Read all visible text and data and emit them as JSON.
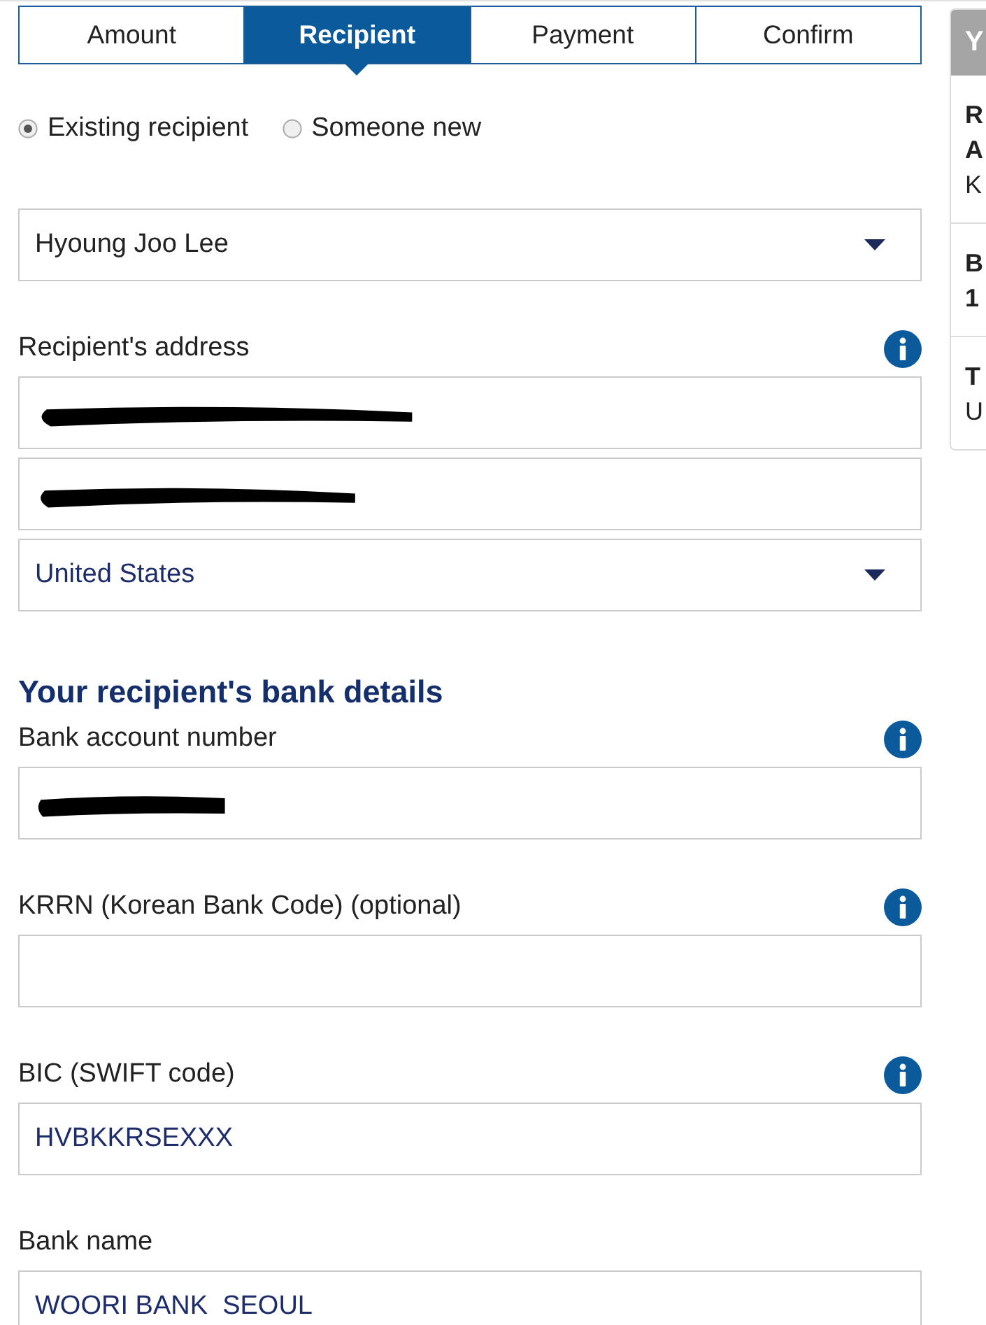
{
  "tabs": [
    {
      "label": "Amount",
      "selected": false
    },
    {
      "label": "Recipient",
      "selected": true
    },
    {
      "label": "Payment",
      "selected": false
    },
    {
      "label": "Confirm",
      "selected": false
    }
  ],
  "recipient_type": [
    {
      "label": "Existing recipient",
      "selected": true
    },
    {
      "label": "Someone new",
      "selected": false
    }
  ],
  "recipient_select": {
    "value": "Hyoung Joo Lee"
  },
  "address": {
    "label": "Recipient's address",
    "info": true,
    "lines": [
      {
        "kind": "text",
        "redacted": true
      },
      {
        "kind": "text",
        "redacted": true
      },
      {
        "kind": "select",
        "value": "United States",
        "redacted": false
      }
    ]
  },
  "bank_details": {
    "heading": "Your recipient's bank details",
    "fields": [
      {
        "label": "Bank account number",
        "info": true,
        "redacted": true
      },
      {
        "label": "KRRN (Korean Bank Code) (optional)",
        "info": true,
        "redacted": false
      },
      {
        "label": "BIC (SWIFT code)",
        "info": true,
        "redacted": false,
        "value": "HVBKKRSEXXX"
      },
      {
        "label": "Bank name",
        "info": false,
        "redacted": false,
        "value": "WOORI BANK  SEOUL"
      }
    ]
  },
  "summary_panel": {
    "title": "Y",
    "sections": [
      {
        "lines": [
          {
            "kind": "strong",
            "text": "R"
          },
          {
            "kind": "strong",
            "text": "A"
          },
          {
            "kind": "plain",
            "text": "K"
          }
        ]
      },
      {
        "lines": [
          {
            "kind": "strong",
            "text": "B"
          },
          {
            "kind": "strong",
            "text": "1"
          }
        ]
      },
      {
        "lines": [
          {
            "kind": "strong",
            "text": "T"
          },
          {
            "kind": "plain",
            "text": "U"
          }
        ]
      }
    ]
  }
}
